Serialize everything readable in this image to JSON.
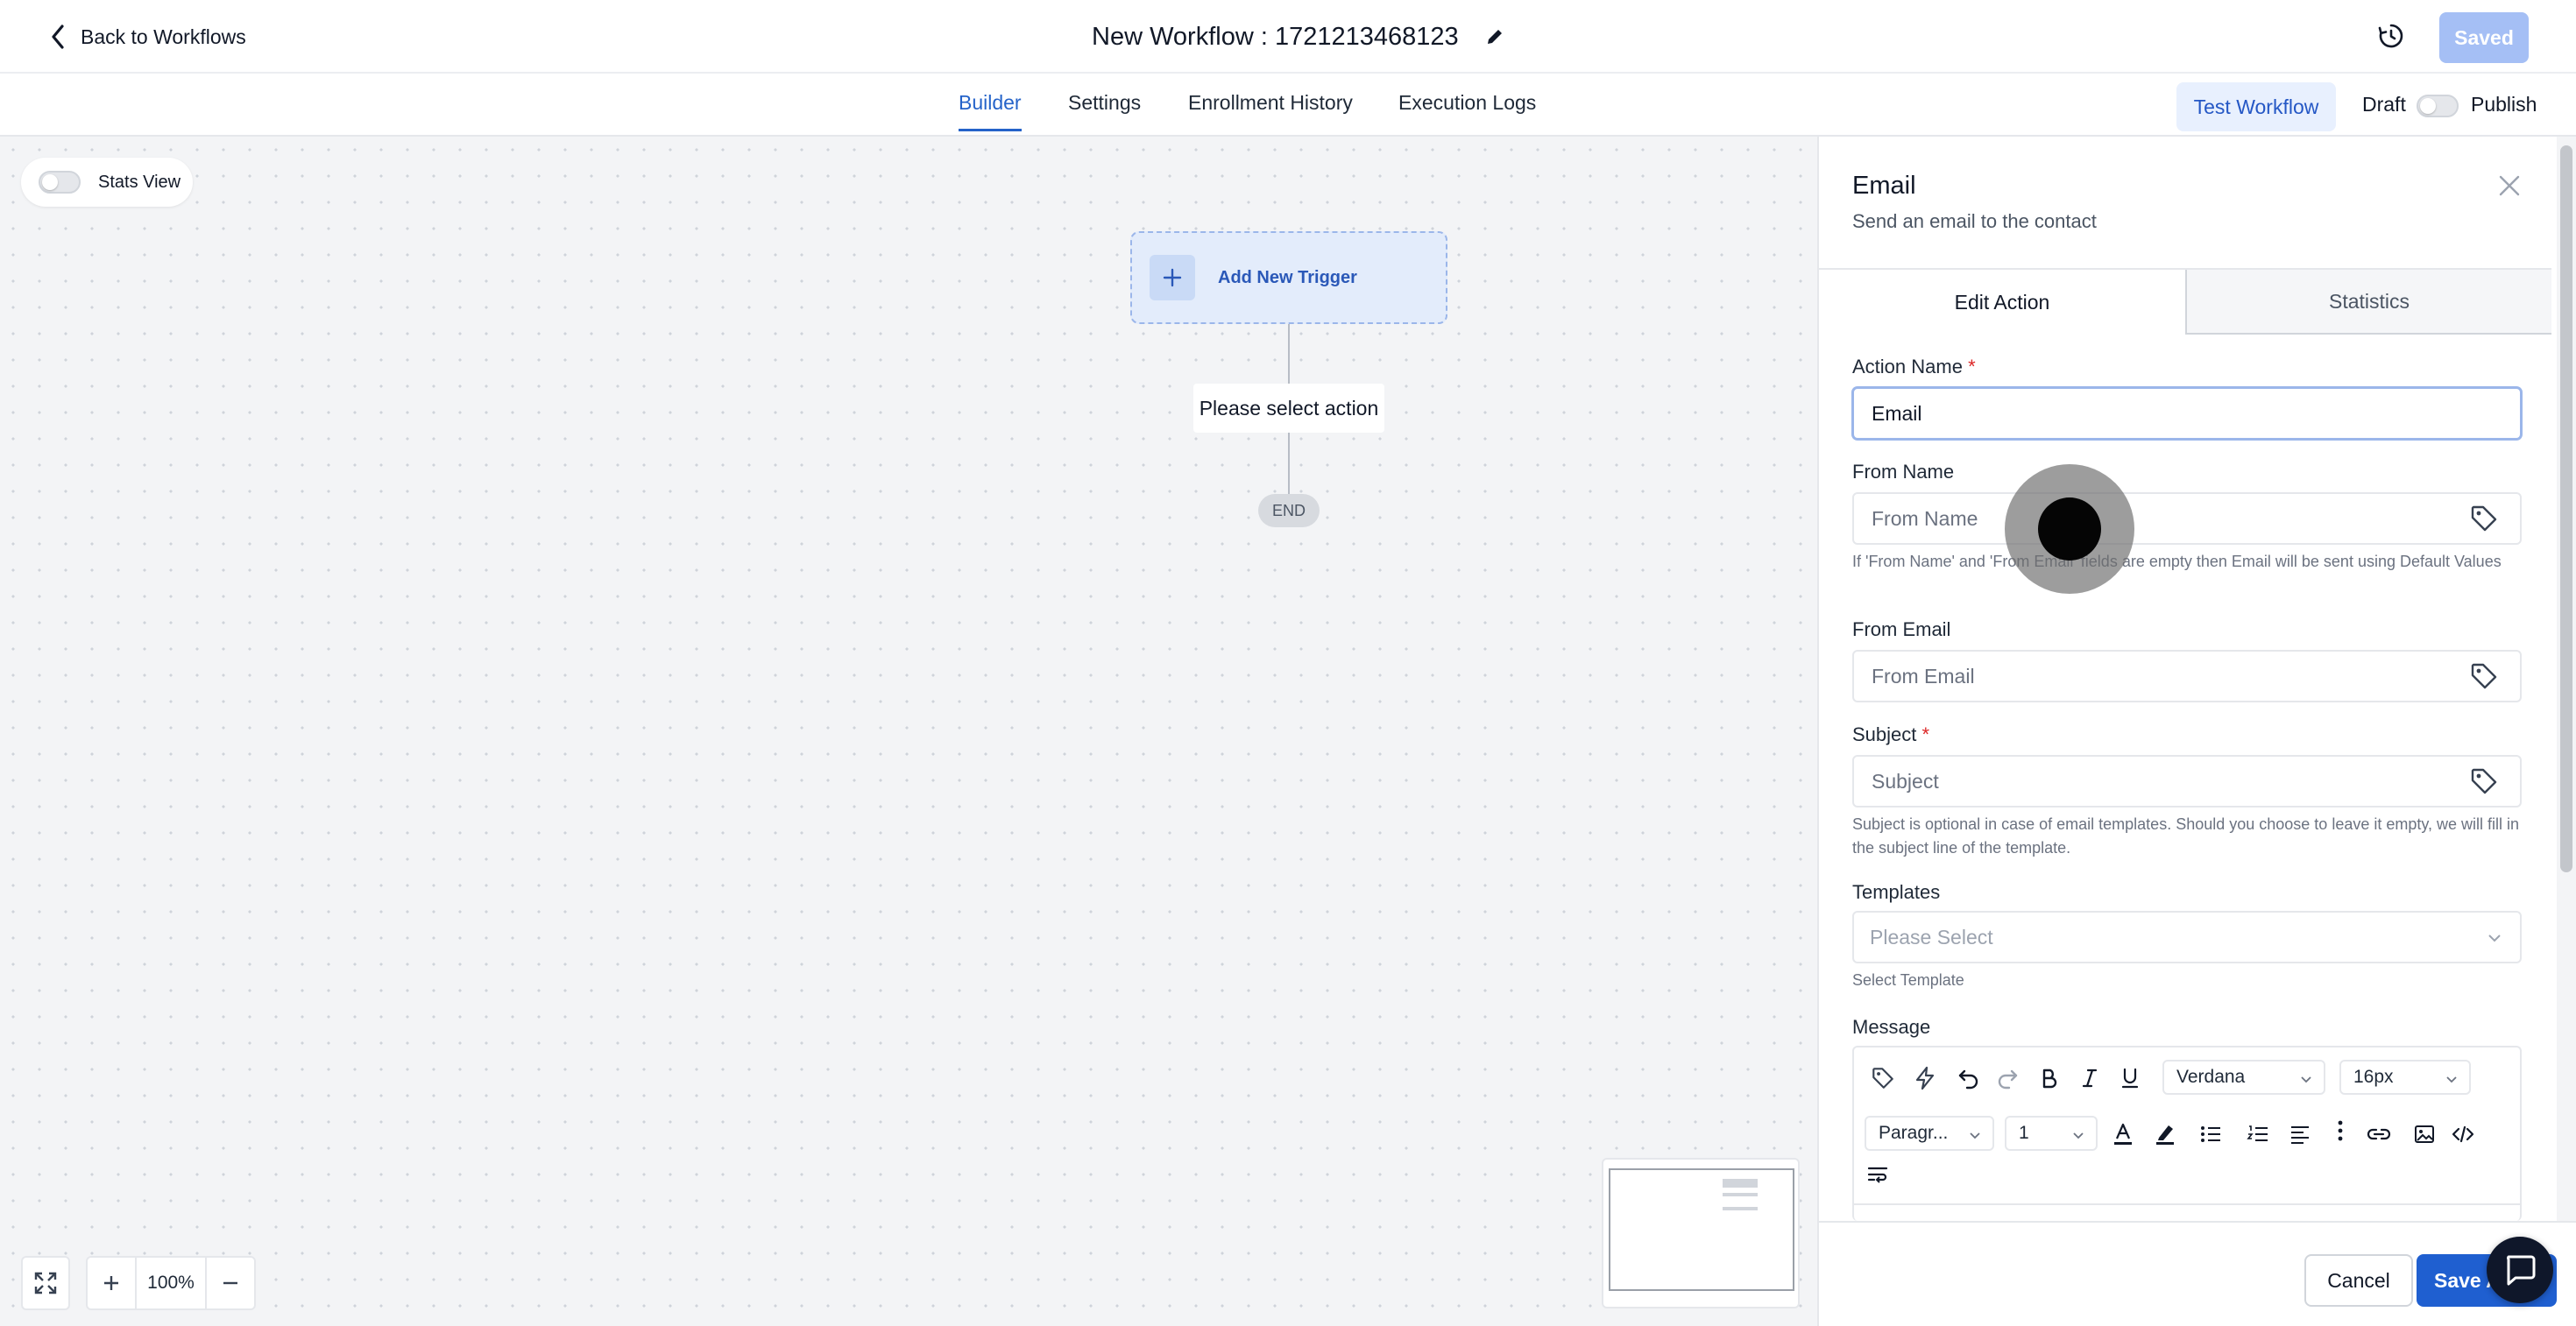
{
  "header": {
    "back_label": "Back to Workflows",
    "workflow_title": "New Workflow : 1721213468123",
    "saved_label": "Saved"
  },
  "tabs": [
    {
      "label": "Builder",
      "active": true
    },
    {
      "label": "Settings",
      "active": false
    },
    {
      "label": "Enrollment History",
      "active": false
    },
    {
      "label": "Execution Logs",
      "active": false
    }
  ],
  "actions": {
    "test_workflow_label": "Test Workflow",
    "draft_label": "Draft",
    "publish_label": "Publish",
    "published": false
  },
  "canvas": {
    "stats_view_label": "Stats View",
    "stats_view_on": false,
    "add_trigger_label": "Add New Trigger",
    "select_action_label": "Please select action",
    "end_label": "END",
    "zoom_level": "100%"
  },
  "panel": {
    "title": "Email",
    "subtitle": "Send an email to the contact",
    "tabs": [
      {
        "label": "Edit Action",
        "active": true
      },
      {
        "label": "Statistics",
        "active": false
      }
    ],
    "fields": {
      "action_name": {
        "label": "Action Name",
        "required_mark": "*",
        "value": "Email"
      },
      "from_name": {
        "label": "From Name",
        "placeholder": "From Name",
        "help": "If 'From Name' and 'From Email' fields are empty then Email will be sent using Default Values"
      },
      "from_email": {
        "label": "From Email",
        "placeholder": "From Email"
      },
      "subject": {
        "label": "Subject",
        "required_mark": "*",
        "placeholder": "Subject",
        "help": "Subject is optional in case of email templates. Should you choose to leave it empty, we will fill in the subject line of the template."
      },
      "templates": {
        "label": "Templates",
        "placeholder": "Please Select",
        "help": "Select Template"
      },
      "message": {
        "label": "Message"
      }
    },
    "editor": {
      "font_family": "Verdana",
      "font_size": "16px",
      "block_format": "Paragr...",
      "line_height": "1"
    },
    "footer": {
      "cancel_label": "Cancel",
      "save_label": "Save Action"
    }
  },
  "colors": {
    "accent": "#2563c9",
    "saved_button": "#a5bff5",
    "save_button": "#1f5fd0",
    "required": "#dc2626"
  }
}
